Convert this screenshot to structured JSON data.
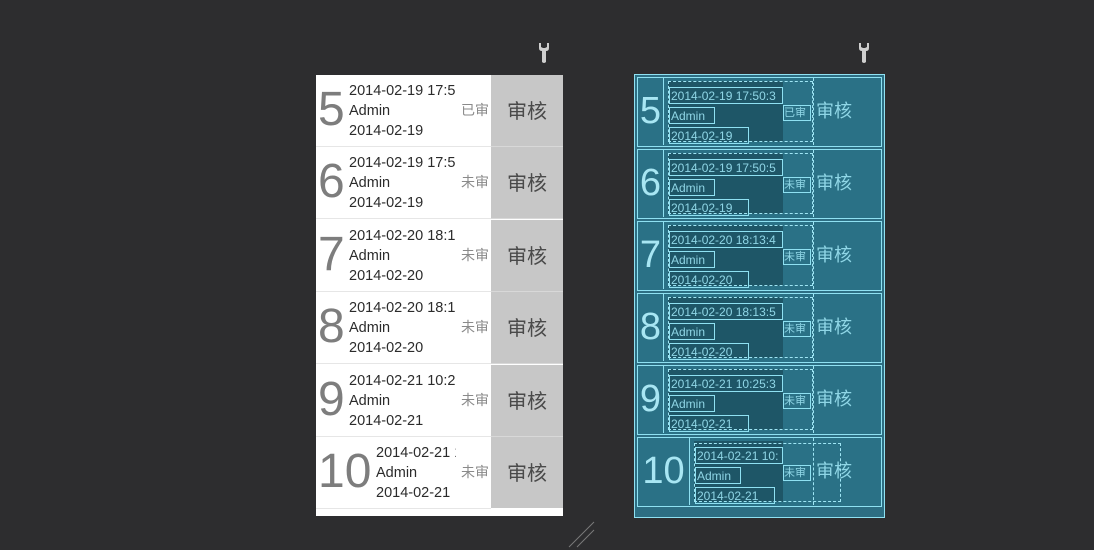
{
  "icons": {
    "design_tool": "wrench-icon",
    "blueprint_tool": "wrench-icon"
  },
  "colors": {
    "background": "#2d2d2f",
    "button": "#c7c7c7",
    "blueprint": "#2d6e83",
    "blueprint_outline": "#8fe1f2"
  },
  "list": {
    "rows": [
      {
        "num": "5",
        "datetime": "2014-02-19 17:50:3",
        "user": "Admin",
        "date": "2014-02-19",
        "status": "已审",
        "action": "审核"
      },
      {
        "num": "6",
        "datetime": "2014-02-19 17:50:5",
        "user": "Admin",
        "date": "2014-02-19",
        "status": "未审",
        "action": "审核"
      },
      {
        "num": "7",
        "datetime": "2014-02-20 18:13:4",
        "user": "Admin",
        "date": "2014-02-20",
        "status": "未审",
        "action": "审核"
      },
      {
        "num": "8",
        "datetime": "2014-02-20 18:13:5",
        "user": "Admin",
        "date": "2014-02-20",
        "status": "未审",
        "action": "审核"
      },
      {
        "num": "9",
        "datetime": "2014-02-21 10:25:3",
        "user": "Admin",
        "date": "2014-02-21",
        "status": "未审",
        "action": "审核"
      },
      {
        "num": "10",
        "datetime": "2014-02-21 10:",
        "user": "Admin",
        "date": "2014-02-21",
        "status": "未审",
        "action": "审核"
      }
    ]
  }
}
